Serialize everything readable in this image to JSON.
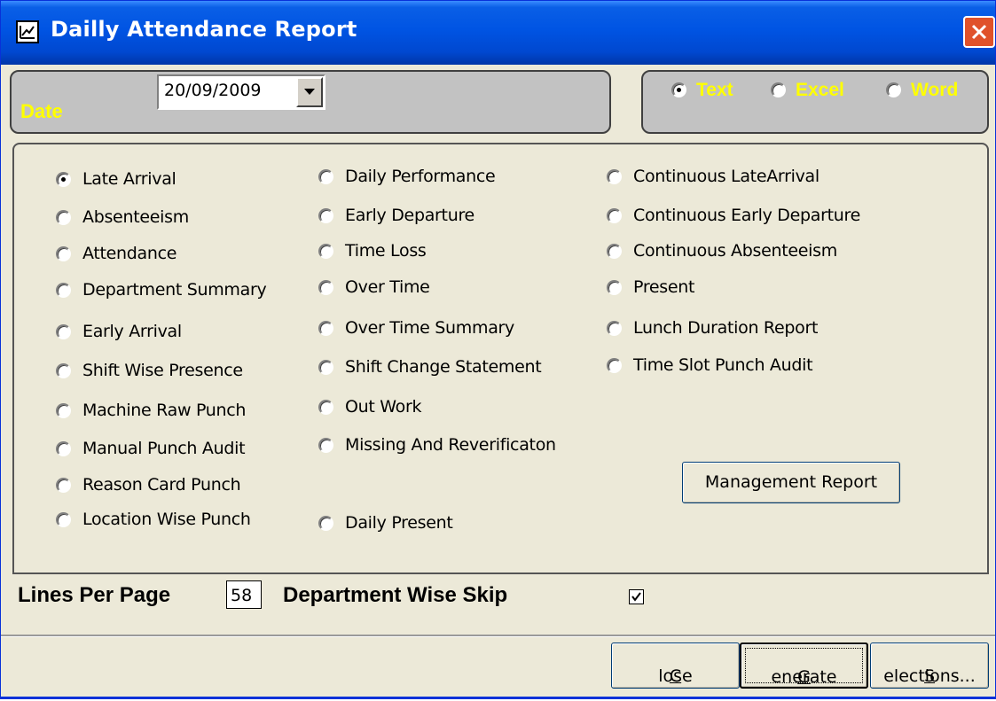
{
  "window": {
    "title": "Dailly Attendance Report"
  },
  "date": {
    "label": "Date",
    "value": "20/09/2009"
  },
  "format": {
    "options": [
      {
        "label": "Text",
        "selected": true
      },
      {
        "label": "Excel",
        "selected": false
      },
      {
        "label": "Word",
        "selected": false
      }
    ]
  },
  "reports": {
    "col1": [
      {
        "label": "Late Arrival",
        "selected": true
      },
      {
        "label": "Absenteeism",
        "selected": false
      },
      {
        "label": "Attendance",
        "selected": false
      },
      {
        "label": "Department Summary",
        "selected": false
      },
      {
        "label": "Early Arrival",
        "selected": false
      },
      {
        "label": "Shift Wise Presence",
        "selected": false
      },
      {
        "label": "Machine Raw Punch",
        "selected": false
      },
      {
        "label": "Manual Punch Audit",
        "selected": false
      },
      {
        "label": "Reason Card Punch",
        "selected": false
      },
      {
        "label": "Location Wise Punch",
        "selected": false
      }
    ],
    "col2": [
      {
        "label": "Daily Performance",
        "selected": false
      },
      {
        "label": "Early Departure",
        "selected": false
      },
      {
        "label": "Time Loss",
        "selected": false
      },
      {
        "label": "Over Time",
        "selected": false
      },
      {
        "label": "Over Time Summary",
        "selected": false
      },
      {
        "label": "Shift Change Statement",
        "selected": false
      },
      {
        "label": "Out Work",
        "selected": false
      },
      {
        "label": "Missing And Reverificaton",
        "selected": false
      },
      {
        "label": "Daily Present",
        "selected": false
      }
    ],
    "col3": [
      {
        "label": "Continuous LateArrival",
        "selected": false
      },
      {
        "label": "Continuous Early Departure",
        "selected": false
      },
      {
        "label": "Continuous Absenteeism",
        "selected": false
      },
      {
        "label": "Present",
        "selected": false
      },
      {
        "label": "Lunch Duration Report",
        "selected": false
      },
      {
        "label": "Time Slot Punch Audit",
        "selected": false
      }
    ],
    "management_button": "Management Report"
  },
  "options": {
    "lines_per_page_label": "Lines Per Page",
    "lines_per_page_value": "58",
    "department_skip_label": "Department Wise Skip",
    "department_skip_checked": true
  },
  "buttons": {
    "close_mnemonic": "C",
    "close_rest": "lose",
    "generate_mnemonic": "G",
    "generate_rest": "enerate",
    "selections_mnemonic": "S",
    "selections_rest": "elections..."
  },
  "colors": {
    "title_bar": "#0054E3",
    "group_bg": "#C2C2C2",
    "highlight_text": "#FFFF00",
    "window_bg": "#ECE9D8",
    "close_button": "#E0512A"
  },
  "icons": [
    "report-icon",
    "close-x-icon",
    "dropdown-arrow-icon",
    "checkmark-icon"
  ]
}
